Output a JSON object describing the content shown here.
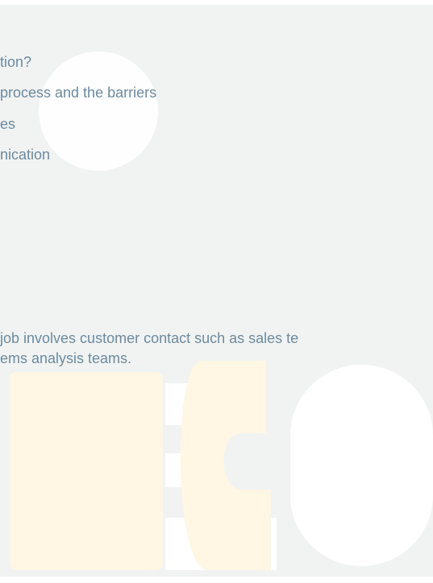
{
  "document": {
    "lines": [
      "tion?",
      "process and the barriers",
      "es",
      "nication"
    ],
    "paragraph": [
      "job involves customer contact such as sales te",
      "ems analysis teams."
    ]
  },
  "logo": {
    "colors": {
      "orange": "#fff6e4",
      "white": "#ffffff"
    }
  }
}
